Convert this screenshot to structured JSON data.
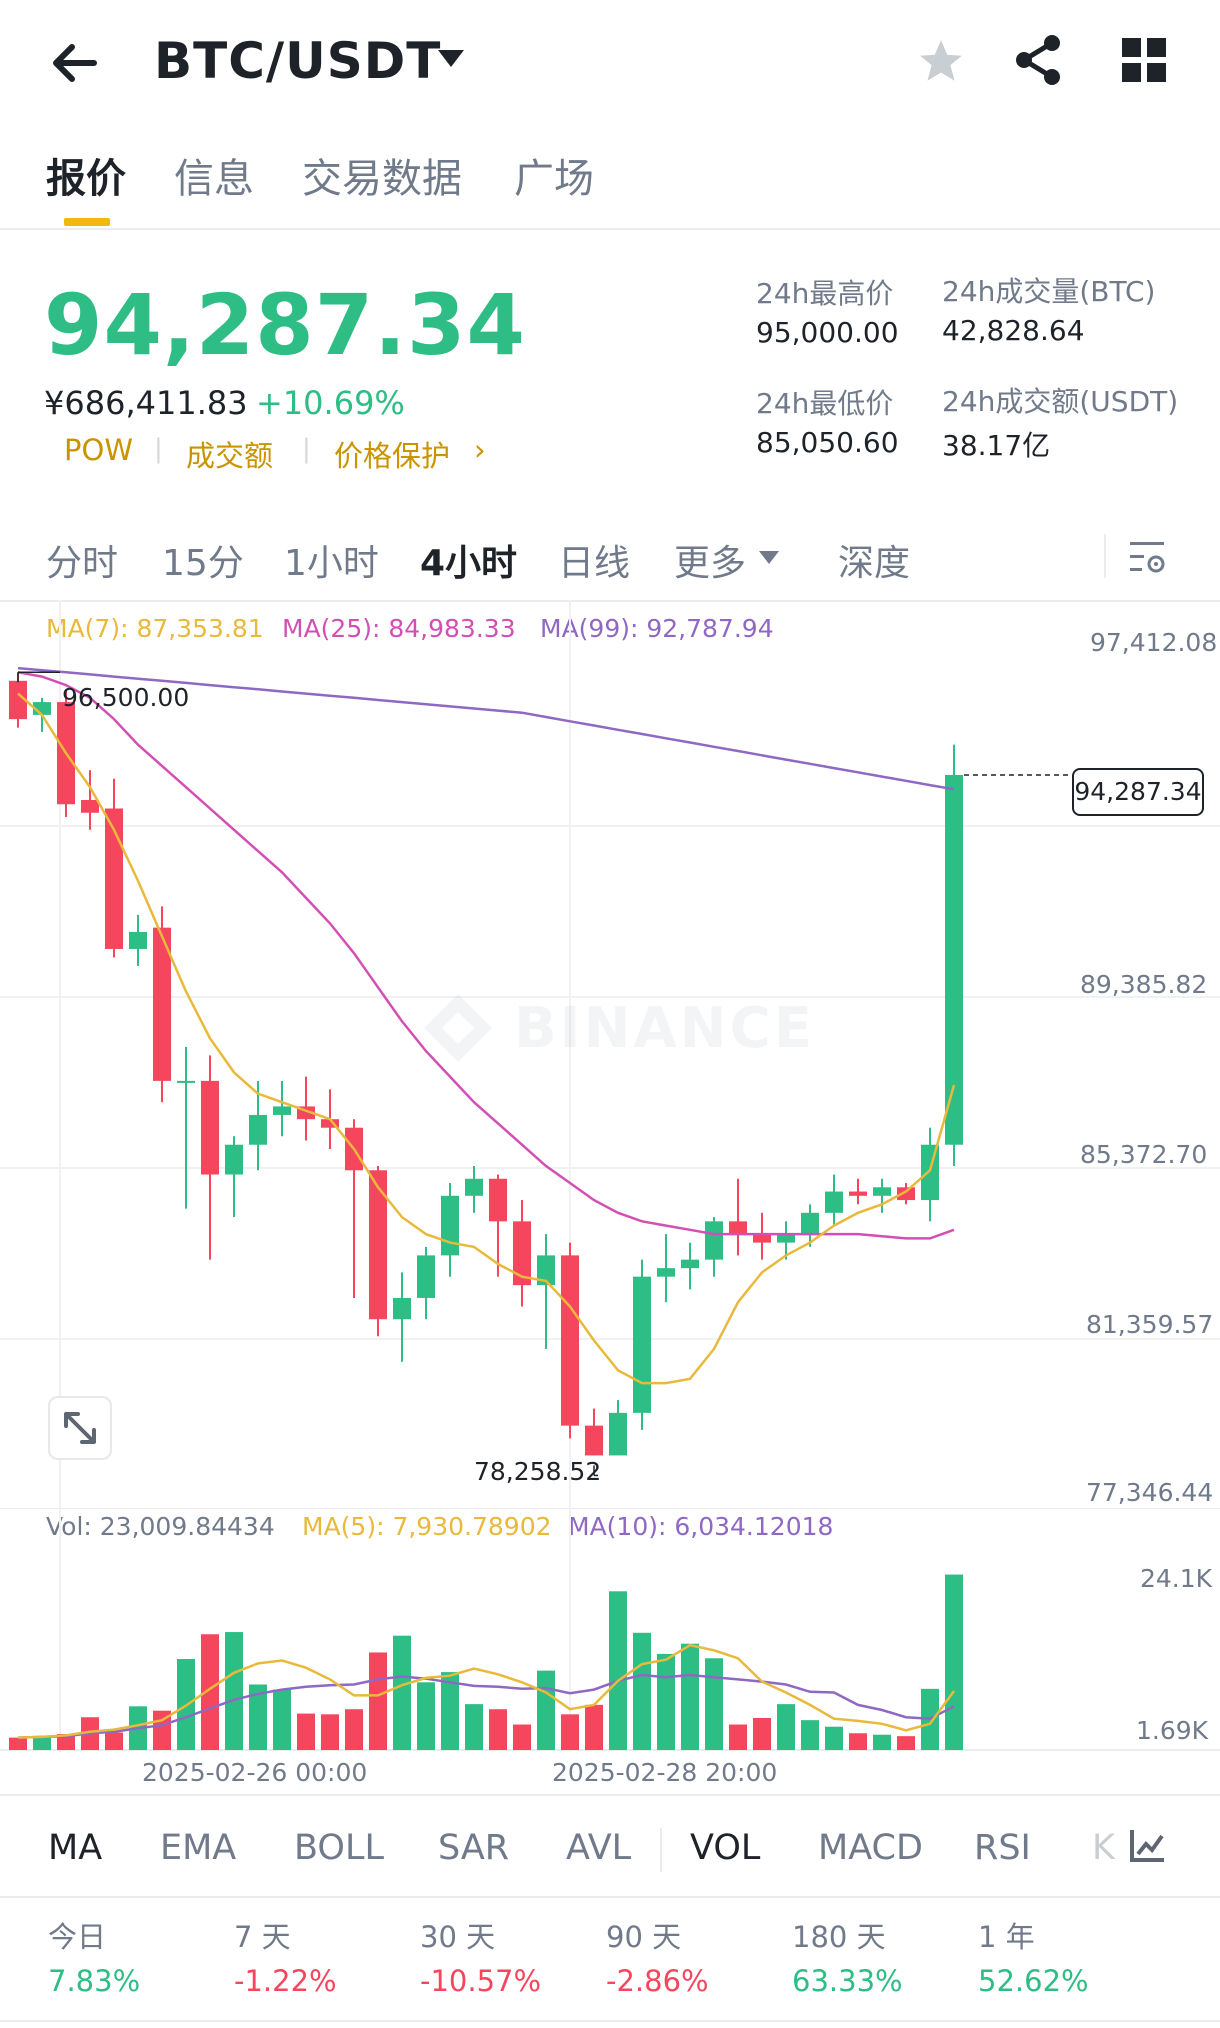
{
  "header": {
    "pair": "BTC/USDT"
  },
  "tabs": [
    "报价",
    "信息",
    "交易数据",
    "广场"
  ],
  "price": {
    "last": "94,287.34",
    "cny": "¥686,411.83",
    "change": "+10.69%",
    "tags": [
      "POW",
      "成交额",
      "价格保护"
    ]
  },
  "stats": {
    "high_label": "24h最高价",
    "high_value": "95,000.00",
    "vol_btc_label": "24h成交量(BTC)",
    "vol_btc_value": "42,828.64",
    "low_label": "24h最低价",
    "low_value": "85,050.60",
    "vol_usdt_label": "24h成交额(USDT)",
    "vol_usdt_value": "38.17亿"
  },
  "intervals": [
    "分时",
    "15分",
    "1小时",
    "4小时",
    "日线",
    "更多",
    "深度"
  ],
  "active_interval": "4小时",
  "ma_labels": {
    "ma7": "MA(7): 87,353.81",
    "ma25": "MA(25): 84,983.33",
    "ma99": "MA(99): 92,787.94"
  },
  "vol_labels": {
    "vol": "Vol: 23,009.84434",
    "ma5": "MA(5): 7,930.78902",
    "ma10": "MA(10): 6,034.12018"
  },
  "price_axis": [
    "97,412.08",
    "89,385.82",
    "85,372.70",
    "81,359.57",
    "77,346.44"
  ],
  "vol_axis": [
    "24.1K",
    "1.69K"
  ],
  "x_labels": [
    "2025-02-26 00:00",
    "2025-02-28 20:00"
  ],
  "annotations": {
    "high_mark": "96,500.00",
    "low_mark": "78,258.52",
    "last_price_tag": "94,287.34",
    "watermark": "BINANCE"
  },
  "indicators": [
    "MA",
    "EMA",
    "BOLL",
    "SAR",
    "AVL",
    "VOL",
    "MACD",
    "RSI",
    "K"
  ],
  "performance": [
    {
      "label": "今日",
      "value": "7.83%"
    },
    {
      "label": "7 天",
      "value": "-1.22%"
    },
    {
      "label": "30 天",
      "value": "-10.57%"
    },
    {
      "label": "90 天",
      "value": "-2.86%"
    },
    {
      "label": "180 天",
      "value": "63.33%"
    },
    {
      "label": "1 年",
      "value": "52.62%"
    }
  ],
  "colors": {
    "up": "#2ebd85",
    "down": "#f6465d",
    "ma7": "#e8b93a",
    "ma25": "#d34fb4",
    "ma99": "#8f68c4",
    "accent": "#f0b90b"
  },
  "chart_data": {
    "type": "candlestick",
    "ylim": [
      77346.44,
      97412.08
    ],
    "candles": [
      {
        "o": 96500,
        "h": 96700,
        "l": 95400,
        "c": 95600
      },
      {
        "o": 95700,
        "h": 96100,
        "l": 95300,
        "c": 96000
      },
      {
        "o": 96000,
        "h": 96300,
        "l": 93300,
        "c": 93600
      },
      {
        "o": 93700,
        "h": 94400,
        "l": 93000,
        "c": 93400
      },
      {
        "o": 93500,
        "h": 94200,
        "l": 90000,
        "c": 90200
      },
      {
        "o": 90200,
        "h": 91000,
        "l": 89800,
        "c": 90600
      },
      {
        "o": 90700,
        "h": 91200,
        "l": 86600,
        "c": 87100
      },
      {
        "o": 87100,
        "h": 87900,
        "l": 84100,
        "c": 87100
      },
      {
        "o": 87100,
        "h": 87700,
        "l": 82900,
        "c": 84900
      },
      {
        "o": 84900,
        "h": 85800,
        "l": 83900,
        "c": 85600
      },
      {
        "o": 85600,
        "h": 87100,
        "l": 85000,
        "c": 86300
      },
      {
        "o": 86300,
        "h": 87100,
        "l": 85800,
        "c": 86500
      },
      {
        "o": 86500,
        "h": 87200,
        "l": 85700,
        "c": 86200
      },
      {
        "o": 86200,
        "h": 86900,
        "l": 85500,
        "c": 86000
      },
      {
        "o": 86000,
        "h": 86200,
        "l": 82000,
        "c": 85000
      },
      {
        "o": 85000,
        "h": 85100,
        "l": 81100,
        "c": 81500
      },
      {
        "o": 81500,
        "h": 82600,
        "l": 80500,
        "c": 82000
      },
      {
        "o": 82000,
        "h": 83200,
        "l": 81500,
        "c": 83000
      },
      {
        "o": 83000,
        "h": 84700,
        "l": 82500,
        "c": 84400
      },
      {
        "o": 84400,
        "h": 85100,
        "l": 84000,
        "c": 84800
      },
      {
        "o": 84800,
        "h": 84900,
        "l": 82500,
        "c": 83800
      },
      {
        "o": 83800,
        "h": 84300,
        "l": 81800,
        "c": 82300
      },
      {
        "o": 82300,
        "h": 83500,
        "l": 80800,
        "c": 83000
      },
      {
        "o": 83000,
        "h": 83300,
        "l": 78700,
        "c": 79000
      },
      {
        "o": 79000,
        "h": 79400,
        "l": 78300,
        "c": 78300
      },
      {
        "o": 78300,
        "h": 79600,
        "l": 78400,
        "c": 79300
      },
      {
        "o": 79300,
        "h": 82900,
        "l": 78900,
        "c": 82500
      },
      {
        "o": 82500,
        "h": 83500,
        "l": 81900,
        "c": 82700
      },
      {
        "o": 82700,
        "h": 83300,
        "l": 82200,
        "c": 82900
      },
      {
        "o": 82900,
        "h": 83900,
        "l": 82500,
        "c": 83800
      },
      {
        "o": 83800,
        "h": 84800,
        "l": 83000,
        "c": 83500
      },
      {
        "o": 83500,
        "h": 84000,
        "l": 82900,
        "c": 83300
      },
      {
        "o": 83300,
        "h": 83800,
        "l": 82900,
        "c": 83500
      },
      {
        "o": 83500,
        "h": 84200,
        "l": 83200,
        "c": 84000
      },
      {
        "o": 84000,
        "h": 84900,
        "l": 83700,
        "c": 84500
      },
      {
        "o": 84500,
        "h": 84800,
        "l": 84200,
        "c": 84400
      },
      {
        "o": 84400,
        "h": 84800,
        "l": 84000,
        "c": 84600
      },
      {
        "o": 84600,
        "h": 84700,
        "l": 84200,
        "c": 84300
      },
      {
        "o": 84300,
        "h": 86000,
        "l": 83800,
        "c": 85600
      },
      {
        "o": 85600,
        "h": 95000,
        "l": 85100,
        "c": 94287.34
      }
    ],
    "ma7": [
      96200,
      95700,
      94800,
      94000,
      93000,
      91800,
      90500,
      89200,
      88100,
      87300,
      86800,
      86600,
      86400,
      86200,
      85500,
      84600,
      83900,
      83500,
      83300,
      83200,
      82800,
      82500,
      82400,
      81800,
      81000,
      80300,
      80000,
      80000,
      80100,
      80800,
      81900,
      82600,
      83000,
      83300,
      83700,
      84000,
      84200,
      84500,
      85000,
      87000
    ],
    "ma25": [
      96700,
      96600,
      96400,
      96100,
      95600,
      95000,
      94500,
      94000,
      93500,
      93000,
      92500,
      92000,
      91400,
      90800,
      90100,
      89300,
      88500,
      87800,
      87200,
      86600,
      86100,
      85600,
      85100,
      84700,
      84300,
      84000,
      83800,
      83700,
      83600,
      83500,
      83500,
      83500,
      83500,
      83500,
      83500,
      83500,
      83450,
      83400,
      83400,
      83600
    ],
    "ma99": [
      96800,
      96750,
      96700,
      96650,
      96600,
      96550,
      96500,
      96450,
      96400,
      96350,
      96300,
      96250,
      96200,
      96150,
      96100,
      96050,
      96000,
      95950,
      95900,
      95850,
      95800,
      95750,
      95650,
      95550,
      95450,
      95350,
      95250,
      95150,
      95050,
      94950,
      94850,
      94750,
      94650,
      94550,
      94450,
      94350,
      94250,
      94150,
      94050,
      93950
    ],
    "volume": [
      1.7,
      1.8,
      2.2,
      4.5,
      2.4,
      6.0,
      5.4,
      12.5,
      15.9,
      16.2,
      9.0,
      8.3,
      5.0,
      4.9,
      5.6,
      13.4,
      15.7,
      9.3,
      10.7,
      6.3,
      5.6,
      3.5,
      10.9,
      4.9,
      6.2,
      21.8,
      16.1,
      13.2,
      14.6,
      12.6,
      3.5,
      4.4,
      6.3,
      4.1,
      3.2,
      2.3,
      2.1,
      1.9,
      8.4,
      24.1
    ],
    "vol_ma5": [
      1.7,
      1.8,
      2.0,
      2.5,
      2.8,
      3.4,
      4.1,
      6.1,
      8.4,
      10.6,
      11.9,
      12.3,
      11.3,
      9.7,
      7.5,
      7.5,
      8.9,
      9.9,
      10.2,
      11.2,
      10.4,
      9.3,
      7.9,
      5.6,
      6.2,
      9.5,
      11.8,
      12.4,
      14.4,
      13.7,
      12.6,
      9.4,
      7.9,
      6.2,
      4.3,
      4.0,
      3.6,
      2.7,
      3.6,
      8.1
    ],
    "vol_ma10": [
      1.7,
      1.8,
      1.9,
      2.3,
      2.5,
      3.0,
      3.4,
      4.5,
      5.7,
      6.9,
      7.7,
      8.3,
      8.7,
      8.9,
      9.0,
      9.7,
      10.1,
      9.8,
      9.3,
      8.8,
      8.7,
      8.4,
      8.5,
      7.8,
      8.3,
      9.5,
      10.3,
      10.0,
      10.3,
      10.0,
      9.7,
      9.4,
      9.0,
      8.0,
      7.9,
      6.2,
      5.5,
      4.5,
      4.3,
      6.0
    ],
    "vol_ylim": [
      0,
      25
    ]
  }
}
